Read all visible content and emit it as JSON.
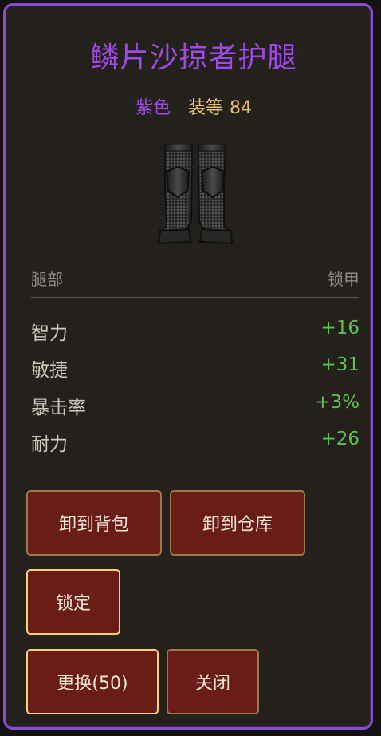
{
  "item": {
    "name": "鳞片沙掠者护腿",
    "quality": "紫色",
    "level_label": "装等",
    "level_value": "84",
    "slot": "腿部",
    "armor_type": "锁甲",
    "image_icon": "mail-leggings-icon"
  },
  "stats": [
    {
      "name": "智力",
      "value": "+16"
    },
    {
      "name": "敏捷",
      "value": "+31"
    },
    {
      "name": "暴击率",
      "value": "+3%"
    },
    {
      "name": "耐力",
      "value": "+26"
    }
  ],
  "buttons": {
    "unequip_to_bag": "卸到背包",
    "unequip_to_warehouse": "卸到仓库",
    "lock": "锁定",
    "replace": "更换(50)",
    "close": "关闭"
  },
  "colors": {
    "border": "#8a4bd0",
    "title": "#9e4ae6",
    "level": "#e6c070",
    "stat_value": "#5fbf4f",
    "button_bg": "#6a1c16"
  }
}
